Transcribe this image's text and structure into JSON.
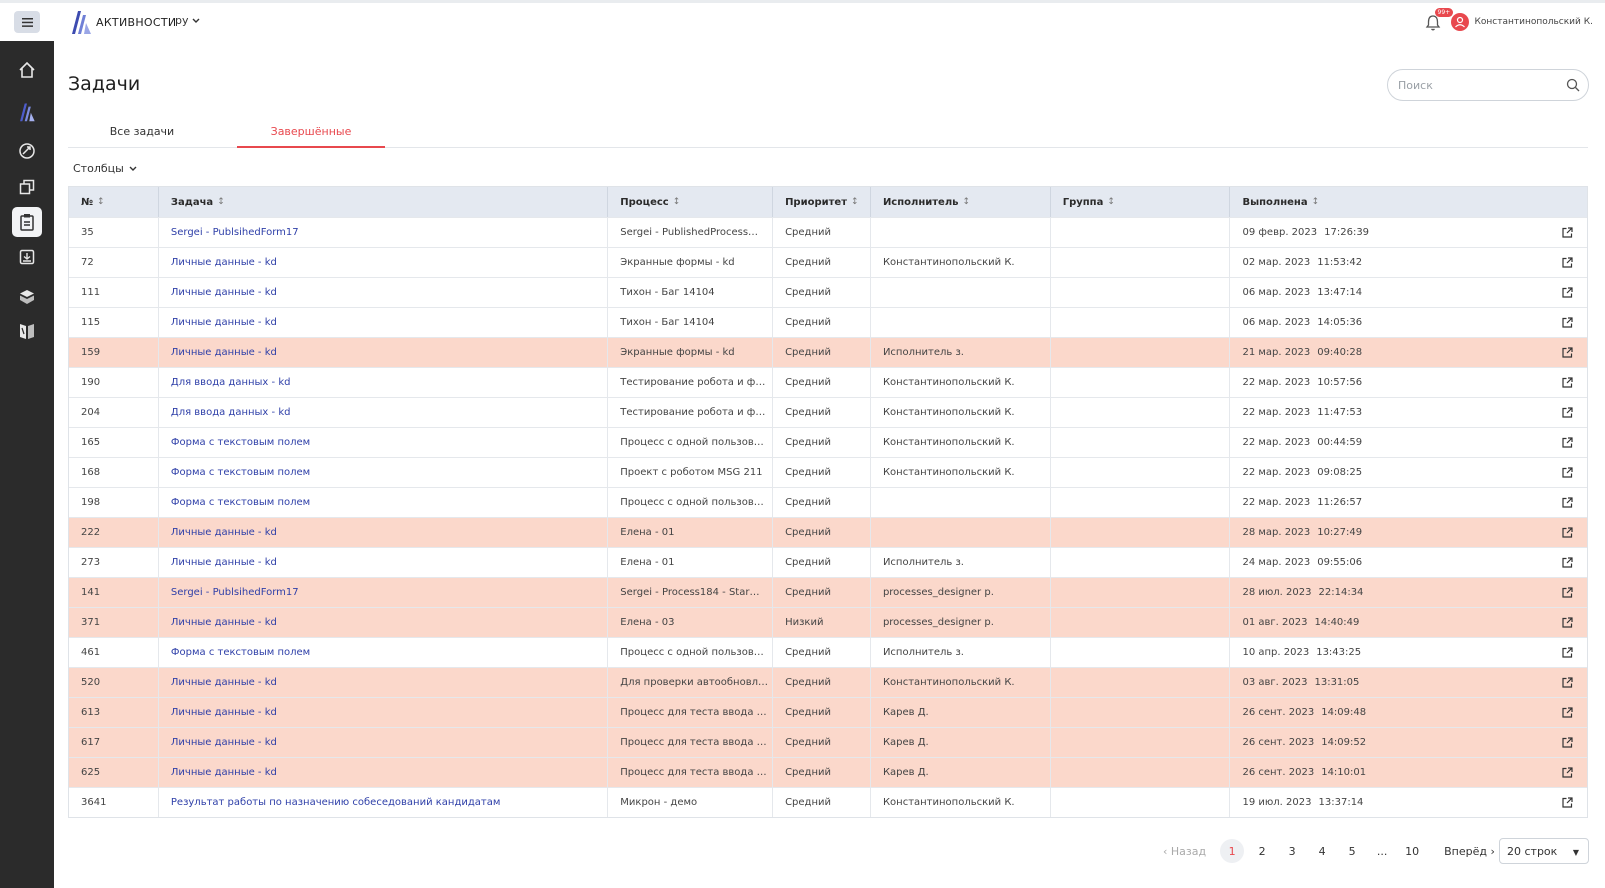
{
  "header": {
    "logo_text": "АКТИВНОСТИ",
    "language": "ру",
    "notifications_badge": "99+",
    "user_name": "Константинопольский К."
  },
  "sidebar": {
    "menu_icon": "hamburger-icon",
    "items": [
      {
        "icon": "home-icon",
        "active": false
      },
      {
        "icon": "logo-icon",
        "active": false
      },
      {
        "icon": "processes-icon",
        "active": false
      },
      {
        "icon": "copy-icon",
        "active": false
      },
      {
        "icon": "tasks-clipboard-icon",
        "active": true
      },
      {
        "icon": "inbox-download-icon",
        "active": false
      },
      {
        "icon": "box-icon",
        "active": false
      },
      {
        "icon": "library-icon",
        "active": false
      }
    ]
  },
  "page": {
    "title": "Задачи",
    "search_placeholder": "Поиск",
    "tabs": [
      {
        "label": "Все задачи",
        "active": false
      },
      {
        "label": "Завершённые",
        "active": true
      }
    ],
    "columns_label": "Столбцы"
  },
  "table": {
    "headers": [
      "№",
      "Задача",
      "Процесс",
      "Приоритет",
      "Исполнитель",
      "Группа",
      "Выполнена"
    ],
    "rows": [
      {
        "num": "35",
        "task": "Sergei - PublsihedForm17",
        "process": "Sergei - PublishedProcess…",
        "priority": "Средний",
        "executor": "",
        "group": "",
        "date": "09 февр. 2023",
        "time": "17:26:39",
        "highlight": false
      },
      {
        "num": "72",
        "task": "Личные данные - kd",
        "process": "Экранные формы - kd",
        "priority": "Средний",
        "executor": "Константинопольский К.",
        "group": "",
        "date": "02 мар. 2023",
        "time": "11:53:42",
        "highlight": false
      },
      {
        "num": "111",
        "task": "Личные данные - kd",
        "process": "Тихон - Баг 14104",
        "priority": "Средний",
        "executor": "",
        "group": "",
        "date": "06 мар. 2023",
        "time": "13:47:14",
        "highlight": false
      },
      {
        "num": "115",
        "task": "Личные данные - kd",
        "process": "Тихон - Баг 14104",
        "priority": "Средний",
        "executor": "",
        "group": "",
        "date": "06 мар. 2023",
        "time": "14:05:36",
        "highlight": false
      },
      {
        "num": "159",
        "task": "Личные данные - kd",
        "process": "Экранные формы - kd",
        "priority": "Средний",
        "executor": "Исполнитель з.",
        "group": "",
        "date": "21 мар. 2023",
        "time": "09:40:28",
        "highlight": true
      },
      {
        "num": "190",
        "task": "Для ввода данных - kd",
        "process": "Тестирование робота и ф…",
        "priority": "Средний",
        "executor": "Константинопольский К.",
        "group": "",
        "date": "22 мар. 2023",
        "time": "10:57:56",
        "highlight": false
      },
      {
        "num": "204",
        "task": "Для ввода данных - kd",
        "process": "Тестирование робота и ф…",
        "priority": "Средний",
        "executor": "Константинопольский К.",
        "group": "",
        "date": "22 мар. 2023",
        "time": "11:47:53",
        "highlight": false
      },
      {
        "num": "165",
        "task": "Форма с текстовым полем",
        "process": "Процесс с одной пользов…",
        "priority": "Средний",
        "executor": "Константинопольский К.",
        "group": "",
        "date": "22 мар. 2023",
        "time": "00:44:59",
        "highlight": false
      },
      {
        "num": "168",
        "task": "Форма с текстовым полем",
        "process": "Проект с роботом MSG 211",
        "priority": "Средний",
        "executor": "Константинопольский К.",
        "group": "",
        "date": "22 мар. 2023",
        "time": "09:08:25",
        "highlight": false
      },
      {
        "num": "198",
        "task": "Форма с текстовым полем",
        "process": "Процесс с одной пользов…",
        "priority": "Средний",
        "executor": "",
        "group": "",
        "date": "22 мар. 2023",
        "time": "11:26:57",
        "highlight": false
      },
      {
        "num": "222",
        "task": "Личные данные - kd",
        "process": "Елена - 01",
        "priority": "Средний",
        "executor": "",
        "group": "",
        "date": "28 мар. 2023",
        "time": "10:27:49",
        "highlight": true
      },
      {
        "num": "273",
        "task": "Личные данные - kd",
        "process": "Елена - 01",
        "priority": "Средний",
        "executor": "Исполнитель з.",
        "group": "",
        "date": "24 мар. 2023",
        "time": "09:55:06",
        "highlight": false
      },
      {
        "num": "141",
        "task": "Sergei - PublsihedForm17",
        "process": "Sergei - Process184 - Star…",
        "priority": "Средний",
        "executor": "processes_designer p.",
        "group": "",
        "date": "28 июл. 2023",
        "time": "22:14:34",
        "highlight": true
      },
      {
        "num": "371",
        "task": "Личные данные - kd",
        "process": "Елена - 03",
        "priority": "Низкий",
        "executor": "processes_designer p.",
        "group": "",
        "date": "01 авг. 2023",
        "time": "14:40:49",
        "highlight": true
      },
      {
        "num": "461",
        "task": "Форма с текстовым полем",
        "process": "Процесс с одной пользов…",
        "priority": "Средний",
        "executor": "Исполнитель з.",
        "group": "",
        "date": "10 апр. 2023",
        "time": "13:43:25",
        "highlight": false
      },
      {
        "num": "520",
        "task": "Личные данные - kd",
        "process": "Для проверки автообновл…",
        "priority": "Средний",
        "executor": "Константинопольский К.",
        "group": "",
        "date": "03 авг. 2023",
        "time": "13:31:05",
        "highlight": true
      },
      {
        "num": "613",
        "task": "Личные данные - kd",
        "process": "Процесс для теста ввода …",
        "priority": "Средний",
        "executor": "Карев Д.",
        "group": "",
        "date": "26 сент. 2023",
        "time": "14:09:48",
        "highlight": true
      },
      {
        "num": "617",
        "task": "Личные данные - kd",
        "process": "Процесс для теста ввода …",
        "priority": "Средний",
        "executor": "Карев Д.",
        "group": "",
        "date": "26 сент. 2023",
        "time": "14:09:52",
        "highlight": true
      },
      {
        "num": "625",
        "task": "Личные данные - kd",
        "process": "Процесс для теста ввода …",
        "priority": "Средний",
        "executor": "Карев Д.",
        "group": "",
        "date": "26 сент. 2023",
        "time": "14:10:01",
        "highlight": true
      },
      {
        "num": "3641",
        "task": "Результат работы по назначению собеседований кандидатам",
        "process": "Микрон - демо",
        "priority": "Средний",
        "executor": "Константинопольский К.",
        "group": "",
        "date": "19 июл. 2023",
        "time": "13:37:14",
        "highlight": false
      }
    ]
  },
  "pagination": {
    "prev_label": "‹ Назад",
    "next_label": "Вперёд ›",
    "pages": [
      "1",
      "2",
      "3",
      "4",
      "5",
      "...",
      "10"
    ],
    "current_page": "1",
    "rows_per_page": "20 строк"
  },
  "colors": {
    "accent": "#e8484e",
    "link": "#2e3fa8",
    "highlight_row": "#fbd8cb",
    "sidebar": "#2b2b2b",
    "table_header": "#e4e9f1"
  }
}
